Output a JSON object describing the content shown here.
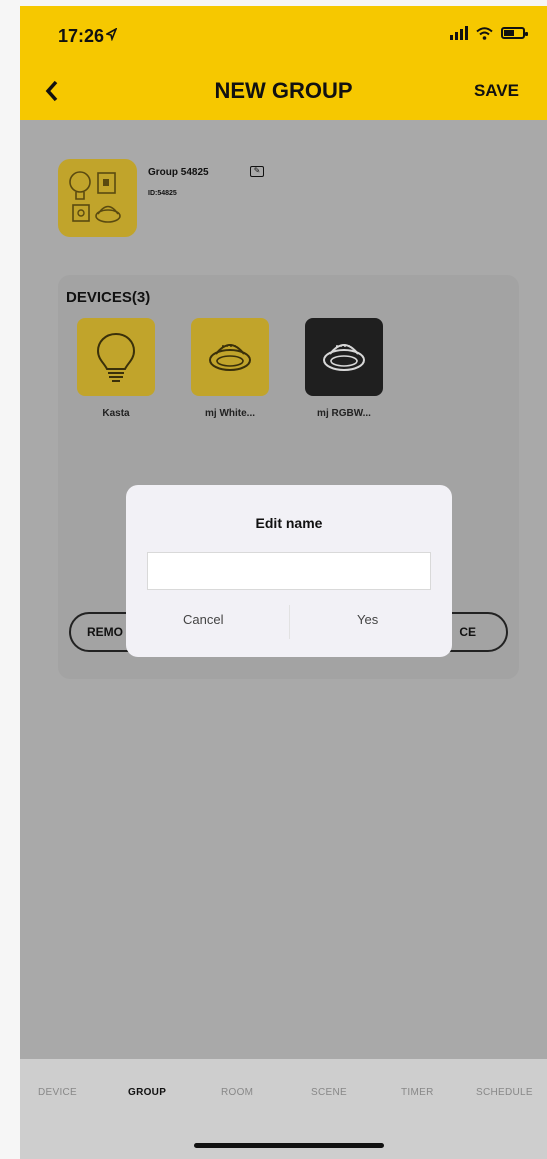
{
  "status_bar": {
    "time": "17:26"
  },
  "nav": {
    "title": "NEW GROUP",
    "save_label": "SAVE"
  },
  "group": {
    "name": "Group 54825",
    "id_text": "ID:54825"
  },
  "devices": {
    "title": "DEVICES(3)",
    "items": [
      {
        "label": "Kasta",
        "icon": "bulb-icon",
        "tile_color": "#c1a42b"
      },
      {
        "label": "mj White...",
        "icon": "downlight-icon",
        "tile_color": "#c1a42b"
      },
      {
        "label": "mj RGBW...",
        "icon": "downlight-icon",
        "tile_color": "#1f1f1f"
      }
    ],
    "remove_label": "REMO",
    "add_label": "CE"
  },
  "dialog": {
    "title": "Edit name",
    "input_value": "",
    "cancel_label": "Cancel",
    "confirm_label": "Yes"
  },
  "tabs": [
    {
      "label": "DEVICE"
    },
    {
      "label": "GROUP"
    },
    {
      "label": "ROOM"
    },
    {
      "label": "SCENE"
    },
    {
      "label": "TIMER"
    },
    {
      "label": "SCHEDULE"
    }
  ],
  "colors": {
    "accent": "#f6c800",
    "overlay": "#a9a9a9"
  }
}
